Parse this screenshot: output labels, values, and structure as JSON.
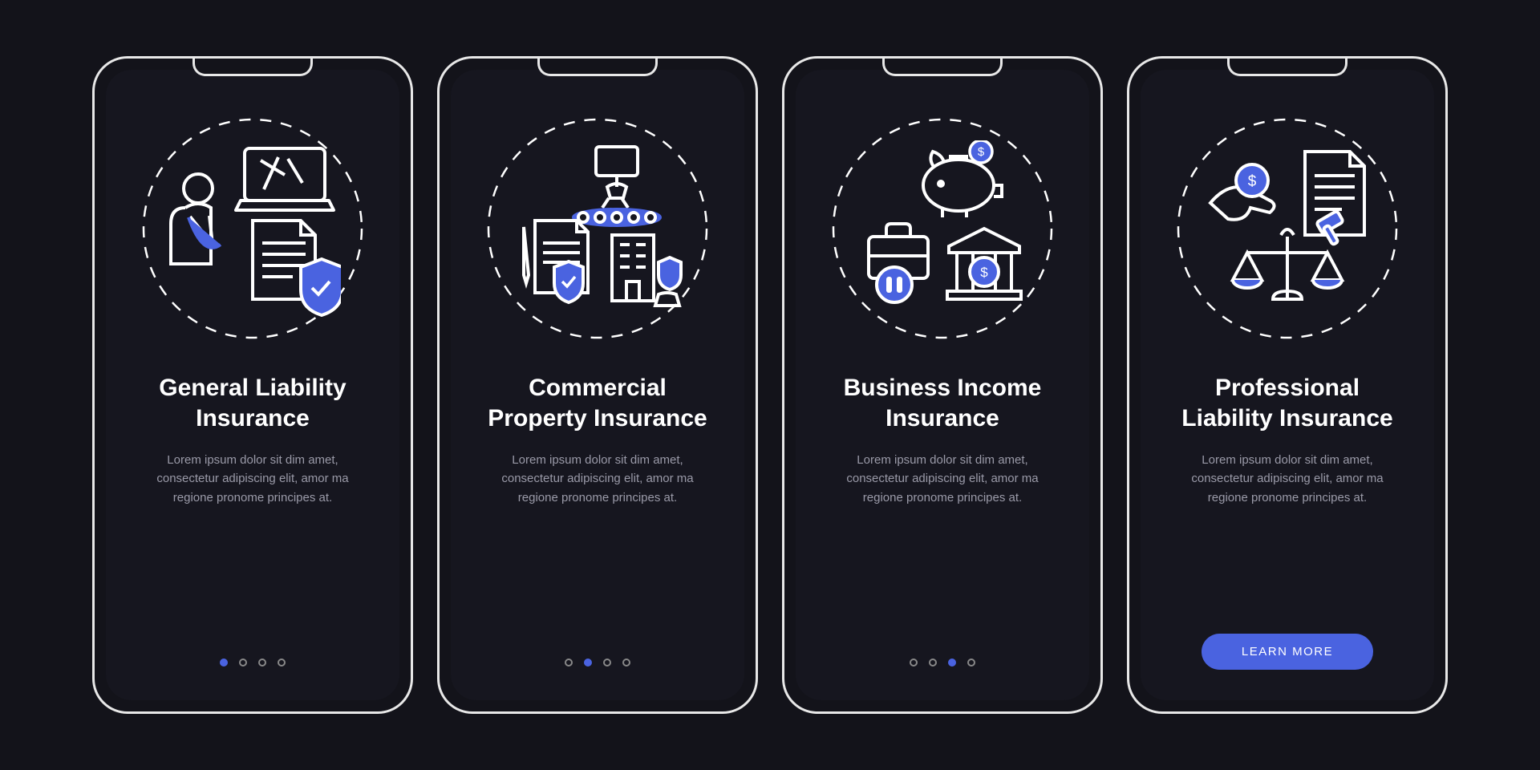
{
  "colors": {
    "accent": "#4a63e0",
    "stroke": "#ffffff",
    "muted": "#9a9aa8"
  },
  "screens": [
    {
      "title": "General Liability Insurance",
      "desc": "Lorem ipsum dolor sit dim amet, consectetur adipiscing elit, amor ma regione pronome principes at.",
      "active_dot": 0,
      "icon": "general-liability-icon"
    },
    {
      "title": "Commercial Property Insurance",
      "desc": "Lorem ipsum dolor sit dim amet, consectetur adipiscing elit, amor ma regione pronome principes at.",
      "active_dot": 1,
      "icon": "commercial-property-icon"
    },
    {
      "title": "Business Income Insurance",
      "desc": "Lorem ipsum dolor sit dim amet, consectetur adipiscing elit, amor ma regione pronome principes at.",
      "active_dot": 2,
      "icon": "business-income-icon"
    },
    {
      "title": "Professional Liability Insurance",
      "desc": "Lorem ipsum dolor sit dim amet, consectetur adipiscing elit, amor ma regione pronome principes at.",
      "active_dot": 3,
      "icon": "professional-liability-icon",
      "cta_label": "LEARN MORE"
    }
  ],
  "dot_count": 4
}
